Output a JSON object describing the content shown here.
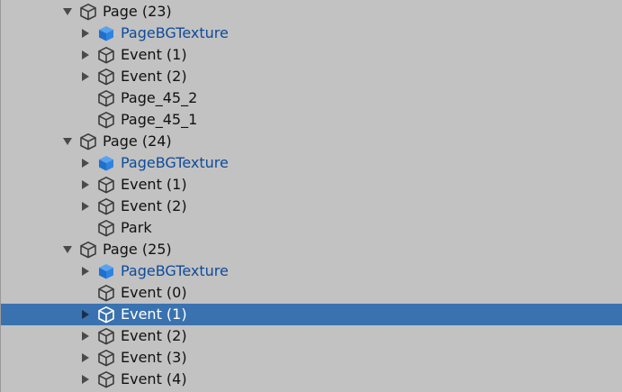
{
  "colors": {
    "background": "#c2c2c2",
    "selection": "#3a72b0",
    "prefab_text": "#0e4b9a",
    "prefab_icon": "#2a7bd6",
    "normal_text": "#111111",
    "icon_stroke": "#3c3c3c"
  },
  "hierarchy": {
    "rows": [
      {
        "label": "Page (23)",
        "level": 0,
        "arrow": "expanded",
        "icon": "gameobject-icon",
        "prefab": false,
        "selected": false
      },
      {
        "label": "PageBGTexture",
        "level": 1,
        "arrow": "collapsed",
        "icon": "prefab-icon",
        "prefab": true,
        "selected": false
      },
      {
        "label": "Event (1)",
        "level": 1,
        "arrow": "collapsed",
        "icon": "gameobject-icon",
        "prefab": false,
        "selected": false
      },
      {
        "label": "Event (2)",
        "level": 1,
        "arrow": "collapsed",
        "icon": "gameobject-icon",
        "prefab": false,
        "selected": false
      },
      {
        "label": "Page_45_2",
        "level": 1,
        "arrow": "none",
        "icon": "gameobject-icon",
        "prefab": false,
        "selected": false
      },
      {
        "label": "Page_45_1",
        "level": 1,
        "arrow": "none",
        "icon": "gameobject-icon",
        "prefab": false,
        "selected": false
      },
      {
        "label": "Page (24)",
        "level": 0,
        "arrow": "expanded",
        "icon": "gameobject-icon",
        "prefab": false,
        "selected": false
      },
      {
        "label": "PageBGTexture",
        "level": 1,
        "arrow": "collapsed",
        "icon": "prefab-icon",
        "prefab": true,
        "selected": false
      },
      {
        "label": "Event (1)",
        "level": 1,
        "arrow": "collapsed",
        "icon": "gameobject-icon",
        "prefab": false,
        "selected": false
      },
      {
        "label": "Event (2)",
        "level": 1,
        "arrow": "collapsed",
        "icon": "gameobject-icon",
        "prefab": false,
        "selected": false
      },
      {
        "label": "Park",
        "level": 1,
        "arrow": "none",
        "icon": "gameobject-icon",
        "prefab": false,
        "selected": false
      },
      {
        "label": "Page (25)",
        "level": 0,
        "arrow": "expanded",
        "icon": "gameobject-icon",
        "prefab": false,
        "selected": false
      },
      {
        "label": "PageBGTexture",
        "level": 1,
        "arrow": "collapsed",
        "icon": "prefab-icon",
        "prefab": true,
        "selected": false
      },
      {
        "label": "Event (0)",
        "level": 1,
        "arrow": "none",
        "icon": "gameobject-icon",
        "prefab": false,
        "selected": false
      },
      {
        "label": "Event (1)",
        "level": 1,
        "arrow": "collapsed",
        "icon": "gameobject-icon",
        "prefab": false,
        "selected": true
      },
      {
        "label": "Event (2)",
        "level": 1,
        "arrow": "collapsed",
        "icon": "gameobject-icon",
        "prefab": false,
        "selected": false
      },
      {
        "label": "Event (3)",
        "level": 1,
        "arrow": "collapsed",
        "icon": "gameobject-icon",
        "prefab": false,
        "selected": false
      },
      {
        "label": "Event (4)",
        "level": 1,
        "arrow": "collapsed",
        "icon": "gameobject-icon",
        "prefab": false,
        "selected": false
      }
    ]
  }
}
